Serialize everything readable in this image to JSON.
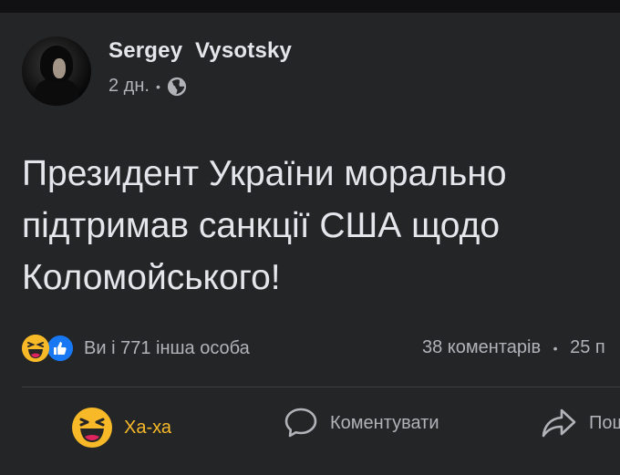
{
  "post": {
    "author": "Sergey  Vysotsky",
    "time": "2 дн.",
    "separator": "•",
    "privacy_icon": "globe-icon",
    "text_lines": [
      "Президент України морально",
      "підтримав санкції США щодо",
      "Коломойського!"
    ]
  },
  "reactions": {
    "icons": [
      "haha-reaction-icon",
      "like-reaction-icon"
    ],
    "summary": "Ви і 771 інша особа"
  },
  "stats": {
    "comments": "38 коментарів",
    "separator": "•",
    "shares": "25 п"
  },
  "actions": {
    "haha_label": "Ха-ха",
    "comment_label": "Коментувати",
    "share_label": "Пош"
  },
  "colors": {
    "background": "#242527",
    "text": "#e4e6eb",
    "secondary_text": "#b0b3b8",
    "haha_yellow": "#f7b928",
    "like_blue": "#1877f2"
  }
}
